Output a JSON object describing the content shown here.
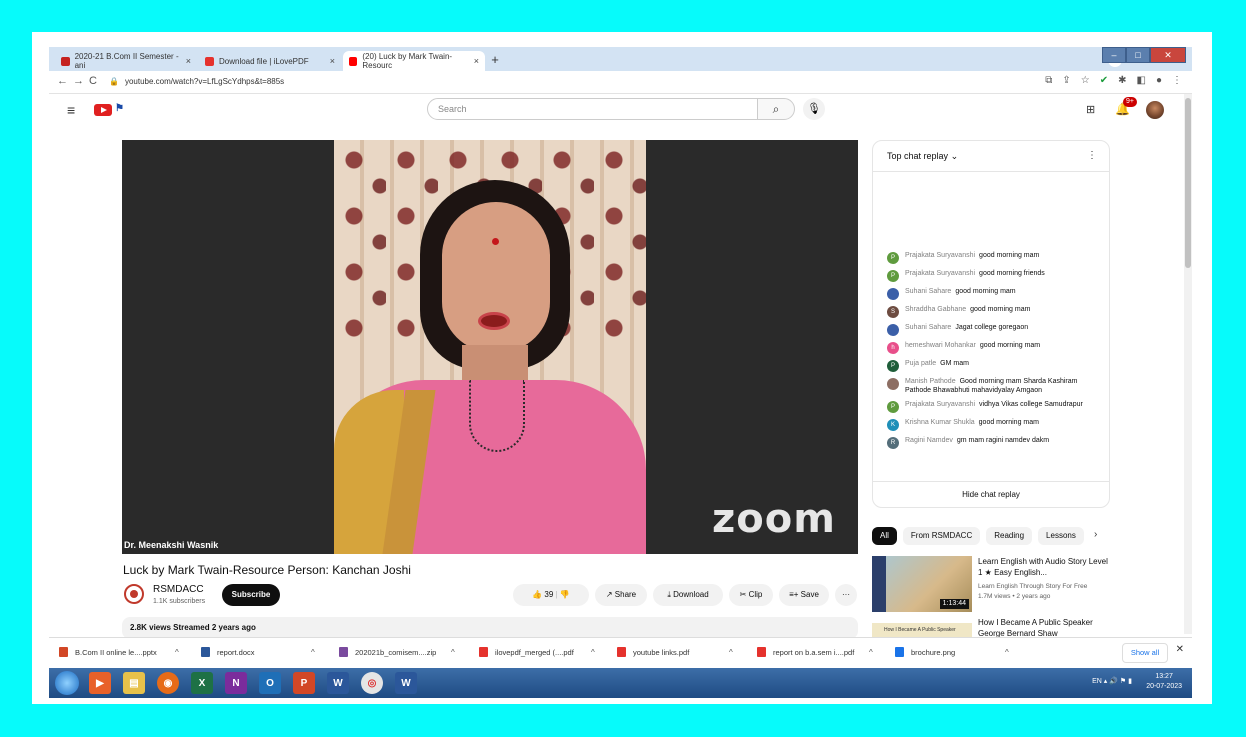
{
  "browser": {
    "tabs": [
      {
        "label": "2020-21 B.Com II Semester - ani",
        "icon": "gmail-icon",
        "color": "#c5221f"
      },
      {
        "label": "Download file | iLovePDF",
        "icon": "ilovepdf-icon",
        "color": "#e5322d"
      },
      {
        "label": "(20) Luck by Mark Twain-Resourc",
        "icon": "youtube-icon",
        "color": "#ff0000",
        "active": true
      }
    ],
    "url": "youtube.com/watch?v=LfLgScYdhps&t=885s"
  },
  "youtube": {
    "search_placeholder": "Search",
    "notification_count": "9+",
    "video": {
      "speaker_name": "Dr. Meenakshi Wasnik",
      "watermark": "zoom",
      "title": "Luck by Mark Twain-Resource Person: Kanchan Joshi",
      "channel": "RSMDACC",
      "subscribers": "1.1K subscribers",
      "subscribe_label": "Subscribe",
      "likes": "39",
      "share_label": "Share",
      "download_label": "Download",
      "clip_label": "Clip",
      "save_label": "Save",
      "views_line": "2.8K views  Streamed 2 years ago"
    },
    "chat": {
      "header": "Top chat replay",
      "hide_label": "Hide chat replay",
      "messages": [
        {
          "name": "Prajakata Suryavanshi",
          "text": "good morning mam",
          "initial": "P",
          "color": "#5f9b3e"
        },
        {
          "name": "Prajakata Suryavanshi",
          "text": "good morning friends",
          "initial": "P",
          "color": "#5f9b3e"
        },
        {
          "name": "Suhani Sahare",
          "text": "good morning mam",
          "initial": "",
          "color": "#3b5fa8"
        },
        {
          "name": "Shraddha Gabhane",
          "text": "good morning mam",
          "initial": "S",
          "color": "#6d4c41"
        },
        {
          "name": "Suhani Sahare",
          "text": "Jagat college goregaon",
          "initial": "",
          "color": "#3b5fa8"
        },
        {
          "name": "hemeshwari Mohankar",
          "text": "good morning mam",
          "initial": "h",
          "color": "#e84f8a"
        },
        {
          "name": "Puja patle",
          "text": "GM mam",
          "initial": "P",
          "color": "#1f5e3a"
        },
        {
          "name": "Manish Pathode",
          "text": "Good morning mam Sharda Kashiram Pathode Bhawabhuti mahavidyalay Amgaon",
          "initial": "",
          "color": "#8d6e63"
        },
        {
          "name": "Prajakata Suryavanshi",
          "text": "vidhya Vikas college Samudrapur",
          "initial": "P",
          "color": "#5f9b3e"
        },
        {
          "name": "Krishna Kumar Shukla",
          "text": "good morning mam",
          "initial": "K",
          "color": "#1f8fb8"
        },
        {
          "name": "Ragini Namdev",
          "text": "gm mam ragini namdev dakm",
          "initial": "R",
          "color": "#546e7a"
        }
      ]
    },
    "chips": [
      "All",
      "From RSMDACC",
      "Reading",
      "Lessons"
    ],
    "recommended": [
      {
        "title": "Learn English with Audio Story Level 1 ★ Easy English...",
        "channel": "Learn English Through Story For Free",
        "meta": "1.7M views • 2 years ago",
        "duration": "1:13:44"
      },
      {
        "title": "How I Became A Public Speaker George Bernard Shaw",
        "thumb_text": "How I Became A Public Speaker"
      }
    ]
  },
  "downloads": {
    "items": [
      {
        "label": "B.Com II online le....pptx",
        "color": "#d24726"
      },
      {
        "label": "report.docx",
        "color": "#2b579a"
      },
      {
        "label": "202021b_comisem....zip",
        "color": "#7a4a9e"
      },
      {
        "label": "ilovepdf_merged (....pdf",
        "color": "#e5322d"
      },
      {
        "label": "youtube links.pdf",
        "color": "#e5322d"
      },
      {
        "label": "report on b.a.sem i....pdf",
        "color": "#e5322d"
      },
      {
        "label": "brochure.png",
        "color": "#1a73e8"
      }
    ],
    "show_all": "Show all"
  },
  "taskbar": {
    "lang": "EN",
    "time": "13:27",
    "date": "20-07-2023"
  }
}
